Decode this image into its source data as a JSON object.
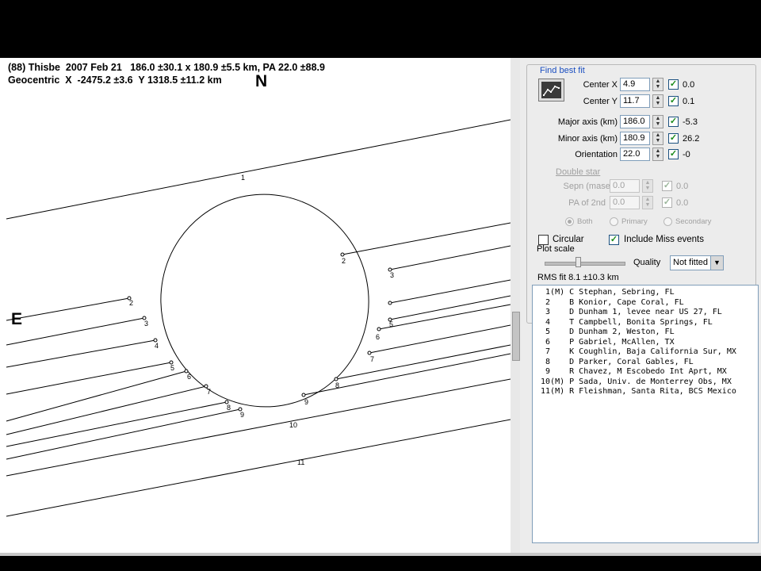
{
  "plot": {
    "header_line1": "(88) Thisbe  2007 Feb 21   186.0 ±30.1 x 180.9 ±5.5 km, PA 22.0 ±88.9",
    "header_line2": "Geocentric  X  -2475.2 ±3.6  Y 1318.5 ±11.2 km",
    "north_label": "N",
    "east_label": "E",
    "chord_labels": [
      "1",
      "2",
      "2",
      "3",
      "3",
      "4",
      "5",
      "5",
      "6",
      "6",
      "7",
      "7",
      "8",
      "8",
      "9",
      "9",
      "10",
      "11"
    ]
  },
  "panel": {
    "find_best_fit": "Find best fit",
    "params": [
      {
        "label": "Center X",
        "value": "4.9",
        "checked": true,
        "result": "0.0"
      },
      {
        "label": "Center Y",
        "value": "11.7",
        "checked": true,
        "result": "0.1"
      },
      {
        "label": "Major axis (km)",
        "value": "186.0",
        "checked": true,
        "result": "-5.3"
      },
      {
        "label": "Minor axis (km)",
        "value": "180.9",
        "checked": true,
        "result": "26.2"
      },
      {
        "label": "Orientation",
        "value": "22.0",
        "checked": true,
        "result": "-0"
      }
    ],
    "double_star": "Double star",
    "double_params": [
      {
        "label": "Sepn (masec)",
        "value": "0.0",
        "result": "0.0"
      },
      {
        "label": "PA of 2nd",
        "value": "0.0",
        "result": "0.0"
      }
    ],
    "radios": [
      "Both",
      "Primary",
      "Secondary"
    ],
    "circular_label": "Circular",
    "circular_checked": false,
    "miss_label": "Include Miss events",
    "miss_checked": true,
    "plot_scale_label": "Plot scale",
    "quality_label": "Quality",
    "quality_value": "Not fitted",
    "rms_fit": "RMS fit 8.1 ±10.3 km",
    "observers": [
      "  1(M) C Stephan, Sebring, FL",
      "  2    B Konior, Cape Coral, FL",
      "  3    D Dunham 1, levee near US 27, FL",
      "  4    T Campbell, Bonita Springs, FL",
      "  5    D Dunham 2, Weston, FL",
      "  6    P Gabriel, McAllen, TX",
      "  7    K Coughlin, Baja California Sur, MX",
      "  8    D Parker, Coral Gables, FL",
      "  9    R Chavez, M Escobedo Int Aprt, MX",
      " 10(M) P Sada, Univ. de Monterrey Obs, MX",
      " 11(M) R Fleishman, Santa Rita, BCS Mexico"
    ]
  }
}
